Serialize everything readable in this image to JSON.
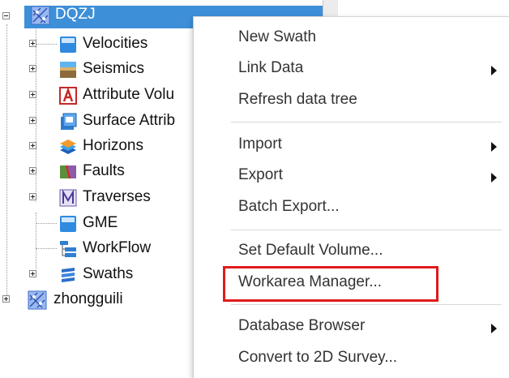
{
  "tree": {
    "root": {
      "label": "DQZJ",
      "icon": "survey-grid-icon",
      "expanded": true
    },
    "children": [
      {
        "label": "Velocities",
        "icon": "velocity-volume-icon",
        "expandable": true
      },
      {
        "label": "Seismics",
        "icon": "seismic-volume-icon",
        "expandable": true
      },
      {
        "label": "Attribute Volu",
        "icon": "attribute-volume-icon",
        "expandable": true
      },
      {
        "label": "Surface Attrib",
        "icon": "surface-attribute-icon",
        "expandable": true
      },
      {
        "label": "Horizons",
        "icon": "horizons-icon",
        "expandable": true
      },
      {
        "label": "Faults",
        "icon": "faults-icon",
        "expandable": true
      },
      {
        "label": "Traverses",
        "icon": "traverse-icon",
        "expandable": true
      },
      {
        "label": "GME",
        "icon": "gme-icon",
        "expandable": false
      },
      {
        "label": "WorkFlow",
        "icon": "workflow-icon",
        "expandable": false
      },
      {
        "label": "Swaths",
        "icon": "swaths-icon",
        "expandable": true
      }
    ],
    "second_root": {
      "label": "zhongguili",
      "icon": "survey-grid-icon",
      "expandable": true
    }
  },
  "context_menu": {
    "items": [
      {
        "label": "New Swath",
        "submenu": false
      },
      {
        "label": "Link Data",
        "submenu": true
      },
      {
        "label": "Refresh data tree",
        "submenu": false
      },
      {
        "label": "Import",
        "submenu": true
      },
      {
        "label": "Export",
        "submenu": true
      },
      {
        "label": "Batch Export...",
        "submenu": false
      },
      {
        "label": "Set Default Volume...",
        "submenu": false
      },
      {
        "label": "Workarea Manager...",
        "submenu": false,
        "highlighted": true
      },
      {
        "label": "Database Browser",
        "submenu": true
      },
      {
        "label": "Convert to 2D Survey...",
        "submenu": false
      }
    ]
  },
  "colors": {
    "selection": "#3d8fd8",
    "highlight_border": "#e01b1b"
  }
}
